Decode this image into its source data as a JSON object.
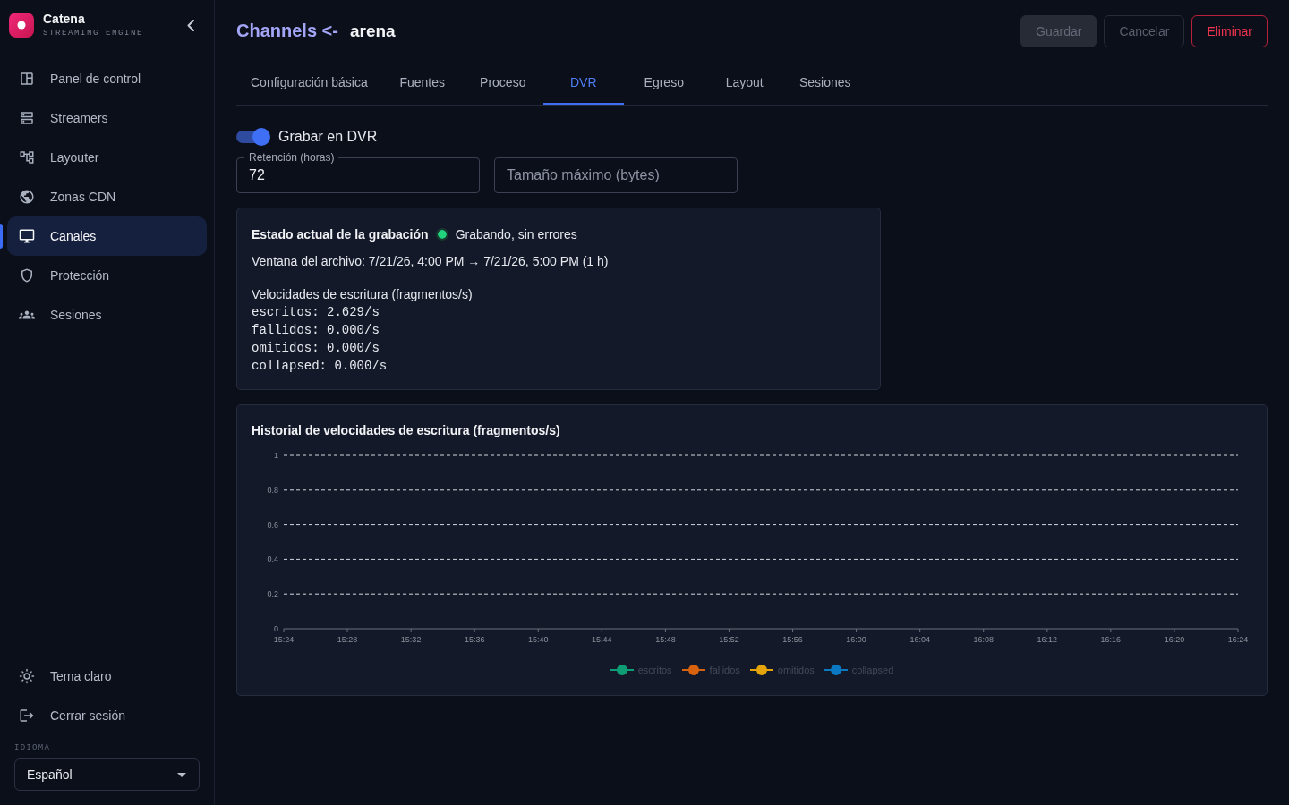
{
  "sidebar": {
    "brand": {
      "name": "Catena",
      "tagline": "STREAMING ENGINE"
    },
    "nav_items": [
      {
        "label": "Panel de control",
        "selected": false
      },
      {
        "label": "Streamers",
        "selected": false
      },
      {
        "label": "Layouter",
        "selected": false
      },
      {
        "label": "Zonas CDN",
        "selected": false
      },
      {
        "label": "Canales",
        "selected": true
      },
      {
        "label": "Protección",
        "selected": false
      },
      {
        "label": "Sesiones",
        "selected": false
      }
    ],
    "footer_items": [
      {
        "label": "Tema claro"
      },
      {
        "label": "Cerrar sesión"
      }
    ],
    "language": {
      "label": "IDIOMA",
      "value": "Español"
    }
  },
  "header": {
    "back_link": "Channels <-",
    "title": "arena",
    "buttons": [
      {
        "label": "Guardar",
        "kind": "primary",
        "disabled": true
      },
      {
        "label": "Cancelar",
        "kind": "outline",
        "disabled": true
      },
      {
        "label": "Eliminar",
        "kind": "danger",
        "disabled": false
      }
    ]
  },
  "tabs": [
    {
      "label": "Configuración básica",
      "selected": false
    },
    {
      "label": "Fuentes",
      "selected": false
    },
    {
      "label": "Proceso",
      "selected": false
    },
    {
      "label": "DVR",
      "selected": true
    },
    {
      "label": "Egreso",
      "selected": false
    },
    {
      "label": "Layout",
      "selected": false
    },
    {
      "label": "Sesiones",
      "selected": false
    }
  ],
  "dvr": {
    "toggle": {
      "label": "Grabar en DVR",
      "on": true
    },
    "fields": [
      {
        "label": "Retención (horas)",
        "value": "72"
      },
      {
        "placeholder": "Tamaño máximo (bytes)"
      }
    ]
  },
  "status_card": {
    "title": "Estado actual de la grabación",
    "status": {
      "text": "Grabando, sin errores",
      "color": "#22d37e"
    },
    "archive_window": "Ventana del archivo: 7/21/26, 4:00 PM → 7/21/26, 5:00 PM (1 h)",
    "rates_title": "Velocidades de escritura (fragmentos/s)",
    "rates": [
      "escritos: 2.629/s",
      "fallidos: 0.000/s",
      "omitidos: 0.000/s",
      "collapsed: 0.000/s"
    ]
  },
  "history_card": {
    "title": "Historial de velocidades de escritura (fragmentos/s)",
    "chart_data": {
      "type": "line",
      "categories": [
        "15:24",
        "15:28",
        "15:32",
        "15:36",
        "15:40",
        "15:44",
        "15:48",
        "15:52",
        "15:56",
        "16:00",
        "16:04",
        "16:08",
        "16:12",
        "16:16",
        "16:20",
        "16:24"
      ],
      "ylim": [
        0,
        1
      ],
      "yticks": [
        0,
        0.2,
        0.4,
        0.6,
        0.8,
        1
      ],
      "grid": true,
      "series": [
        {
          "name": "escritos",
          "color": "#0f9d76",
          "values": [
            null,
            null,
            null,
            null,
            null,
            null,
            null,
            null,
            null,
            null,
            null,
            null,
            null,
            null,
            null,
            null
          ]
        },
        {
          "name": "fallidos",
          "color": "#d9620e",
          "values": [
            null,
            null,
            null,
            null,
            null,
            null,
            null,
            null,
            null,
            null,
            null,
            null,
            null,
            null,
            null,
            null
          ]
        },
        {
          "name": "omitidos",
          "color": "#e5a50a",
          "values": [
            null,
            null,
            null,
            null,
            null,
            null,
            null,
            null,
            null,
            null,
            null,
            null,
            null,
            null,
            null,
            null
          ]
        },
        {
          "name": "collapsed",
          "color": "#0a78c2",
          "values": [
            null,
            null,
            null,
            null,
            null,
            null,
            null,
            null,
            null,
            null,
            null,
            null,
            null,
            null,
            null,
            null
          ]
        }
      ]
    }
  }
}
